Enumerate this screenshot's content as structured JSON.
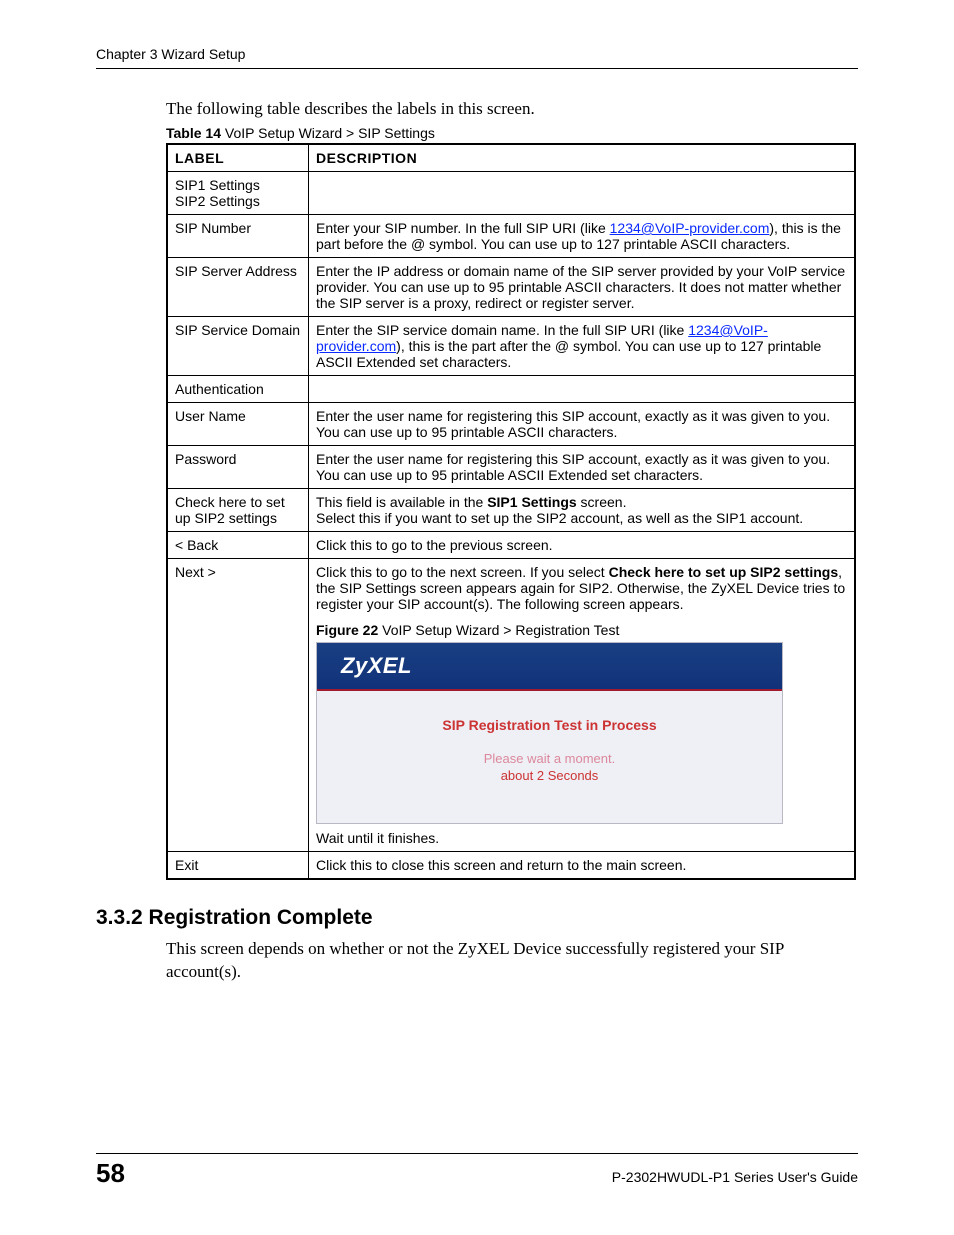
{
  "header": {
    "chapter": "Chapter 3 Wizard Setup"
  },
  "intro": "The following table describes the labels in this screen.",
  "tableCaption": {
    "boldPart": "Table 14",
    "rest": "   VoIP Setup Wizard > SIP Settings"
  },
  "table": {
    "head": {
      "c1": "LABEL",
      "c2": "DESCRIPTION"
    },
    "rows": {
      "r0": {
        "label": "SIP1 Settings\nSIP2 Settings",
        "desc": ""
      },
      "r1": {
        "label": "SIP Number",
        "descParts": {
          "p1": "Enter your SIP number. In the full SIP URI (like ",
          "link": "1234@VoIP-provider.com",
          "p2": "), this is the part before the @ symbol. You can use up to 127 printable ASCII characters."
        }
      },
      "r2": {
        "label": "SIP Server Address",
        "desc": "Enter the IP address or domain name of the SIP server provided by your VoIP service provider. You can use up to 95 printable ASCII characters. It does not matter whether the SIP server is a proxy, redirect or register server."
      },
      "r3": {
        "label": "SIP Service Domain",
        "descParts": {
          "p1": "Enter the SIP service domain name. In the full SIP URI (like ",
          "link": "1234@VoIP-provider.com",
          "p2": "), this is the part after the @ symbol. You can use up to 127 printable ASCII Extended set characters."
        }
      },
      "r4": {
        "label": "Authentication",
        "desc": ""
      },
      "r5": {
        "label": "User Name",
        "desc": "Enter the user name for registering this SIP account, exactly as it was given to you. You can use up to 95 printable ASCII characters."
      },
      "r6": {
        "label": "Password",
        "desc": "Enter the user name for registering this SIP account, exactly as it was given to you. You can use up to 95 printable ASCII Extended set characters."
      },
      "r7": {
        "label": "Check here to set up SIP2 settings",
        "descParts": {
          "p1": "This field is available in the ",
          "bold": "SIP1 Settings",
          "p2": " screen.",
          "line2": "Select this if you want to set up the SIP2 account, as well as the SIP1 account."
        }
      },
      "r8": {
        "label": "< Back",
        "desc": "Click this to go to the previous screen."
      },
      "r9": {
        "label": "Next >",
        "descParts": {
          "p1": "Click this to go to the next screen. If you select ",
          "b1": "Check here to set up SIP2 settings",
          "p2": ", the SIP Settings screen appears again for SIP2. Otherwise, the ZyXEL Device tries to register your SIP account(s). The following screen appears.",
          "figCapBold": "Figure 22",
          "figCapRest": "   VoIP Setup Wizard > Registration Test",
          "brand": "ZyXEL",
          "figTitle": "SIP Registration Test in Process",
          "figSub": "Please wait a moment.",
          "figSub2": "about 2 Seconds",
          "after": "Wait until it finishes."
        }
      },
      "r10": {
        "label": "Exit",
        "desc": "Click this to close this screen and return to the main screen."
      }
    }
  },
  "section": {
    "heading": "3.3.2  Registration Complete",
    "body": "This screen depends on whether or not the ZyXEL Device successfully registered your SIP account(s)."
  },
  "footer": {
    "pageNumber": "58",
    "guide": "P-2302HWUDL-P1 Series User's Guide"
  }
}
